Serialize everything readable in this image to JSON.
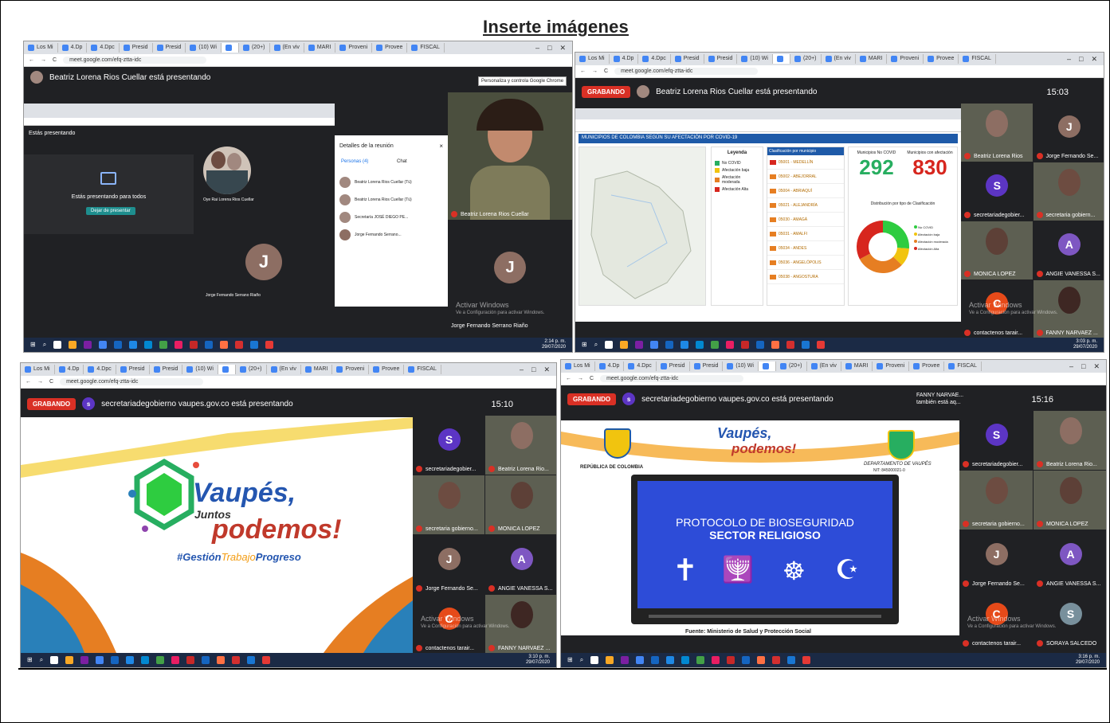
{
  "page_title": "Inserte imágenes",
  "common": {
    "tabs": [
      "Los Mi",
      "4.Dp",
      "4.Dpc",
      "Presid",
      "Presid",
      "(10) Wi",
      "",
      "(20+)",
      "(En viv",
      "MARI",
      "Proveni",
      "Provee",
      "FISCAL"
    ],
    "url": "meet.google.com/efq-ztta-idc",
    "activar_title": "Activar Windows",
    "activar_sub": "Ve a Configuración para activar Windows.",
    "date": "29/07/2020"
  },
  "s1": {
    "presenter": "Beatriz Lorena Rios Cuellar está presentando",
    "inner_presenting": "Estás presentando",
    "inner_msg": "Estás presentando para todos",
    "inner_stop": "Dejar de presentar",
    "details_title": "Detalles de la reunión",
    "people_tab": "Personas (4)",
    "chat_tab": "Chat",
    "people": [
      "Beatriz Lorena Rios Cuellar (Tú)",
      "Beatriz Lorena Rios Cuellar (Tú)",
      "Secretaría JOSÉ DIEGO PE...",
      "Jorge Fernando Serrano..."
    ],
    "center_name": "Oye Rai Lorena Rios Cuellar",
    "big_person": "Beatriz Lorena Rios Cuellar",
    "jorge_name": "Jorge Fernando Serrano Riaño",
    "jorge_initial": "J",
    "time": "2:14 p. m.",
    "chrome_note": "Personaliza y controla Google Chrome"
  },
  "s2": {
    "rec": "GRABANDO",
    "presenter": "Beatriz Lorena Rios Cuellar está presentando",
    "clock": "15:03",
    "map_header": "MUNICIPIOS DE COLOMBIA SEGÚN SU AFECTACIÓN POR COVID-19",
    "leyenda": "Leyenda",
    "clasificacion": "Clasificación por municipio",
    "no_covid_label": "Municipios No COVID",
    "no_covid": "292",
    "afect_label": "Municipios con afectación",
    "afect": "830",
    "dist_label": "Distribución por tipo de Clasificación",
    "legend": [
      "No COVID",
      "Afectación baja",
      "Afectación moderada",
      "Afectación Alta"
    ],
    "donut": [
      {
        "label": "No COVID",
        "value": 26.02,
        "color": "#2ecc40"
      },
      {
        "label": "Afectación baja",
        "value": 11.17,
        "color": "#f1c40f"
      },
      {
        "label": "Afectación moderada",
        "value": 30.06,
        "color": "#e67e22"
      },
      {
        "label": "Afectación Alta",
        "value": 32.75,
        "color": "#d7261e"
      }
    ],
    "munis": [
      "05001 - MEDELLÍN",
      "05002 - ABEJORRAL",
      "05004 - ABRIAQUÍ",
      "05021 - ALEJANDRÍA",
      "05030 - AMAGÁ",
      "05031 - AMALFI",
      "05034 - ANDES",
      "05036 - ANGELÓPOLIS",
      "05038 - ANGOSTURA"
    ],
    "participants": [
      {
        "n": "Beatriz Lorena Rios",
        "i": "",
        "c": "#8d6e63"
      },
      {
        "n": "Jorge Fernando Se...",
        "i": "J",
        "c": "#8d6e63"
      },
      {
        "n": "secretariadegobier...",
        "i": "S",
        "c": "#5c35c4"
      },
      {
        "n": "secretaria gobiern...",
        "i": "",
        "c": "#6d4c41"
      },
      {
        "n": "MONICA LOPEZ",
        "i": "",
        "c": "#5d4037"
      },
      {
        "n": "ANGIE VANESSA S...",
        "i": "A",
        "c": "#7e57c2"
      },
      {
        "n": "contactenos tarair...",
        "i": "C",
        "c": "#e64a19"
      },
      {
        "n": "FANNY NARVAEZ ...",
        "i": "",
        "c": "#3e2723"
      }
    ],
    "time": "3:03 p. m."
  },
  "s3": {
    "rec": "GRABANDO",
    "presenter": "secretariadegobierno vaupes.gov.co está presentando",
    "clock": "15:10",
    "logo_main": "Vaupés,",
    "logo_juntos": "Juntos",
    "logo_podemos": "podemos!",
    "hashtag_a": "#Gestión",
    "hashtag_b": "Trabajo",
    "hashtag_c": "Progreso",
    "participants": [
      {
        "n": "secretariadegobier...",
        "i": "S",
        "c": "#5c35c4"
      },
      {
        "n": "Beatriz Lorena Rio...",
        "i": "",
        "c": "#8d6e63"
      },
      {
        "n": "secretaria gobierno...",
        "i": "",
        "c": "#6d4c41"
      },
      {
        "n": "MONICA LOPEZ",
        "i": "",
        "c": "#5d4037"
      },
      {
        "n": "Jorge Fernando Se...",
        "i": "J",
        "c": "#8d6e63"
      },
      {
        "n": "ANGIE VANESSA S...",
        "i": "A",
        "c": "#7e57c2"
      },
      {
        "n": "contactenos tarair...",
        "i": "C",
        "c": "#e64a19"
      },
      {
        "n": "FANNY NARVAEZ ...",
        "i": "",
        "c": "#3e2723"
      }
    ],
    "time": "3:10 p. m."
  },
  "s4": {
    "rec": "GRABANDO",
    "presenter": "secretariadegobierno vaupes.gov.co está presentando",
    "also": "FANNY NARVAE... también está aq...",
    "clock": "15:16",
    "rep": "REPÚBLICA DE COLOMBIA",
    "dep": "DEPARTAMENTO DE VAUPÉS",
    "nit": "NIT: 845000021-0",
    "proto1": "PROTOCOLO DE BIOSEGURIDAD",
    "proto2": "SECTOR RELIGIOSO",
    "fuente": "Fuente: Ministerio de Salud y Protección Social",
    "participants": [
      {
        "n": "secretariadegobier...",
        "i": "S",
        "c": "#5c35c4"
      },
      {
        "n": "Beatriz Lorena Rio...",
        "i": "",
        "c": "#8d6e63"
      },
      {
        "n": "secretaria gobierno...",
        "i": "",
        "c": "#6d4c41"
      },
      {
        "n": "MONICA LOPEZ",
        "i": "",
        "c": "#5d4037"
      },
      {
        "n": "Jorge Fernando Se...",
        "i": "J",
        "c": "#8d6e63"
      },
      {
        "n": "ANGIE VANESSA S...",
        "i": "A",
        "c": "#7e57c2"
      },
      {
        "n": "contactenos tarair...",
        "i": "C",
        "c": "#e64a19"
      },
      {
        "n": "SORAYA SALCEDO",
        "i": "S",
        "c": "#78909c"
      }
    ],
    "time": "3:16 p. m."
  }
}
